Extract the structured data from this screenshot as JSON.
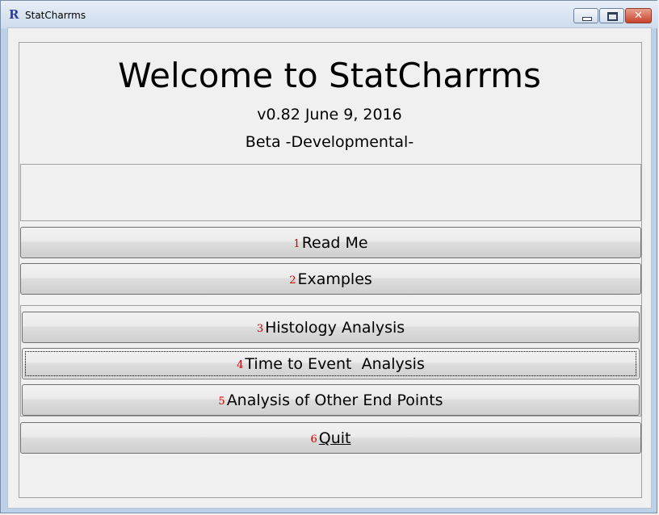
{
  "window": {
    "title": "StatCharrms",
    "app_icon": "R",
    "controls": {
      "minimize": "minimize-icon",
      "maximize": "maximize-icon",
      "close": "close-icon"
    }
  },
  "header": {
    "title": "Welcome to StatCharrms",
    "version": "v0.82 June 9, 2016",
    "status": "Beta -Developmental-"
  },
  "buttons": [
    {
      "number": "1",
      "label": "Read Me"
    },
    {
      "number": "2",
      "label": "Examples"
    },
    {
      "number": "3",
      "label": "Histology Analysis"
    },
    {
      "number": "4",
      "label": "Time to Event  Analysis"
    },
    {
      "number": "5",
      "label": "Analysis of Other End Points"
    },
    {
      "number": "6",
      "label": "Quit"
    }
  ],
  "colors": {
    "number_color": "#cc0000",
    "titlebar": "#cedced",
    "close_button": "#c7432c"
  }
}
